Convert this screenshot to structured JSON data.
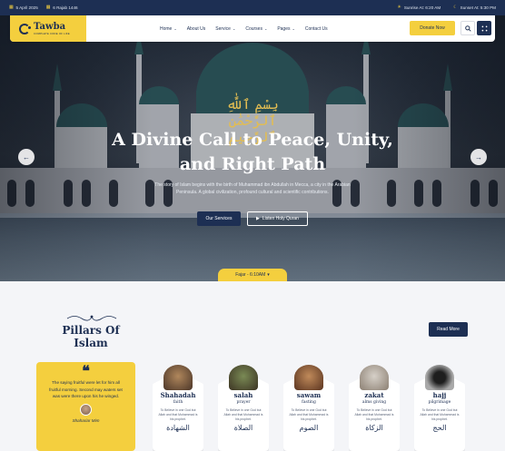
{
  "topbar": {
    "date_greg": "5 April 2025",
    "date_hijri": "6 Rajab 1446",
    "sunrise": "Sunrise At: 6:20 AM",
    "sunset": "Sunset At: 5:30 PM"
  },
  "header": {
    "logo_name": "Tawba",
    "logo_tagline": "COMPLETE CODE OF LIFE",
    "nav": [
      {
        "label": "Home",
        "has_dropdown": true
      },
      {
        "label": "About Us",
        "has_dropdown": false
      },
      {
        "label": "Service",
        "has_dropdown": true
      },
      {
        "label": "Courses",
        "has_dropdown": true
      },
      {
        "label": "Pages",
        "has_dropdown": true
      },
      {
        "label": "Contact Us",
        "has_dropdown": false
      }
    ],
    "donate_label": "Donate Now",
    "chevron": "⌄"
  },
  "hero": {
    "calligraphy": "بِسْمِ ٱللَّٰهِ ٱلرَّحْمَٰنِ ٱلرَّحِيمِ",
    "title_line1": "A Divine Call to Peace, Unity,",
    "title_line2": "and Right Path",
    "text": "The story of Islam begins with the birth of Muhammad ibn Abdullah in Mecca, a city in the Arabian Peninsula. A global civilization, profound cultural and scientific contributions.",
    "btn_services": "Our Services",
    "btn_quran": "Listen Holy Quran",
    "prayer_label": "Fajar - 6:10AM",
    "prayer_chevron": "▾"
  },
  "pillars": {
    "title": "Pillars Of Islam",
    "read_more": "Read More",
    "testimonial": {
      "quote_mark": "❝",
      "text": "The saying fruitful were let for him all fruitful morning. Second may waters set was were there upon his he winged.",
      "author": "Shahariar Mim"
    },
    "cards": [
      {
        "name": "Shahadah",
        "sub": "faith",
        "desc": "To Believe in one God but Allah and that Muhammad is his prophet.",
        "arabic": "الشهادة"
      },
      {
        "name": "salah",
        "sub": "prayer",
        "desc": "To Believe in one God but Allah and that Muhammad is his prophet.",
        "arabic": "الصلاة"
      },
      {
        "name": "sawam",
        "sub": "fasting",
        "desc": "To Believe in one God but Allah and that Muhammad is his prophet.",
        "arabic": "الصوم"
      },
      {
        "name": "zakat",
        "sub": "alms giving",
        "desc": "To Believe in one God but Allah and that Muhammad is his prophet.",
        "arabic": "الزكاة"
      },
      {
        "name": "hajj",
        "sub": "pilgrimage",
        "desc": "To Believe in one God but Allah and that Muhammad is his prophet.",
        "arabic": "الحج"
      }
    ]
  },
  "icons": {
    "calendar": "calendar-icon",
    "moon": "moon-icon",
    "sun": "sun-icon",
    "search": "search-icon",
    "menu": "menu-icon",
    "prev": "arrow-left-icon",
    "next": "arrow-right-icon",
    "play": "play-icon"
  },
  "colors": {
    "navy": "#1d2f53",
    "gold": "#f4cf3e"
  }
}
